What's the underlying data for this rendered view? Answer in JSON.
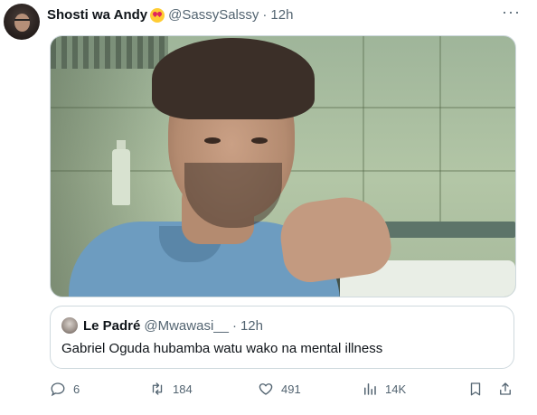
{
  "tweet": {
    "author_name": "Shosti wa Andy",
    "emoji": "heart-eyes-emoji",
    "handle": "@SassySalssy",
    "separator": "·",
    "time": "12h",
    "more": "···"
  },
  "quoted_tweet": {
    "author_name": "Le Padré",
    "handle": "@Mwawasi__",
    "separator": "·",
    "time": "12h",
    "text": "Gabriel Oguda hubamba watu wako na mental illness"
  },
  "actions": {
    "replies": "6",
    "retweets": "184",
    "likes": "491",
    "views": "14K"
  },
  "colors": {
    "secondary_text": "#536471",
    "border": "#cfd9de",
    "text": "#0f1419"
  },
  "icons": [
    "reply-icon",
    "retweet-icon",
    "like-icon",
    "views-icon",
    "bookmark-icon",
    "share-icon",
    "more-icon"
  ]
}
